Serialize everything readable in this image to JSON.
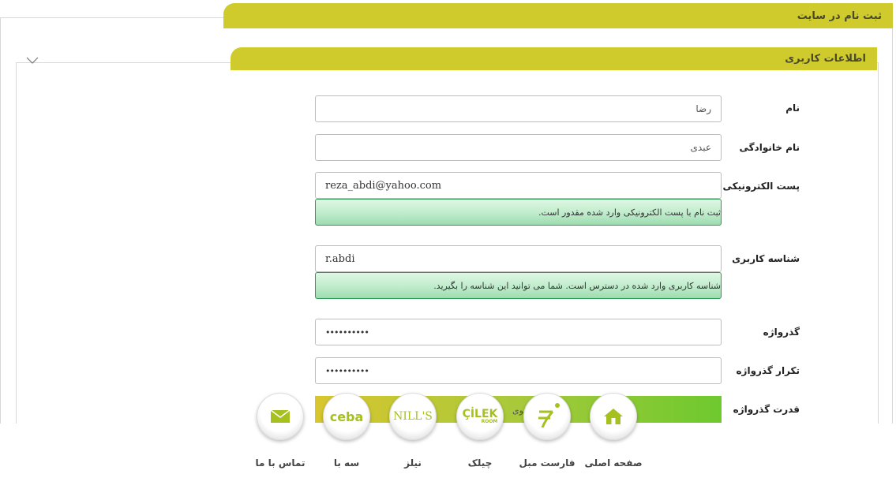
{
  "header": {
    "title": "ثبت نام در سایت"
  },
  "section": {
    "title": "اطلاعات کاربری"
  },
  "form": {
    "first_name": {
      "label": "نام",
      "value": "رضا"
    },
    "last_name": {
      "label": "نام خانوادگی",
      "value": "عبدی"
    },
    "email": {
      "label": "پست الکترونیکی",
      "value": "reza_abdi@yahoo.com",
      "message": "ثبت نام با پست الکترونیکی وارد شده مقدور است."
    },
    "username": {
      "label": "شناسه کاربری",
      "value": "r.abdi",
      "message": "شناسه کاربری وارد شده در دسترس است. شما می توانید این شناسه را بگیرید."
    },
    "password": {
      "label": "گذرواژه",
      "value": "••••••••••"
    },
    "password_confirm": {
      "label": "تکرار گذرواژه",
      "value": "••••••••••"
    },
    "strength": {
      "label": "قدرت گذرواژه",
      "value_text": "قوی"
    }
  },
  "nav": [
    {
      "label": "صفحه اصلی",
      "icon": "home-icon"
    },
    {
      "label": "فارست مبل",
      "icon": "forest-logo-icon"
    },
    {
      "label": "چیلک",
      "icon": "cilek-logo-icon",
      "logo_text": "ÇİLEK",
      "logo_sub": "ROOM"
    },
    {
      "label": "نیلز",
      "icon": "nills-logo-icon",
      "logo_text": "NILL'S"
    },
    {
      "label": "سه با",
      "icon": "ceba-logo-icon",
      "logo_text": "ceba"
    },
    {
      "label": "تماس با ما",
      "icon": "mail-icon"
    }
  ],
  "colors": {
    "accent": "#cfcb2c",
    "success_border": "#2f9a55",
    "logo_green": "#a6c01f"
  }
}
